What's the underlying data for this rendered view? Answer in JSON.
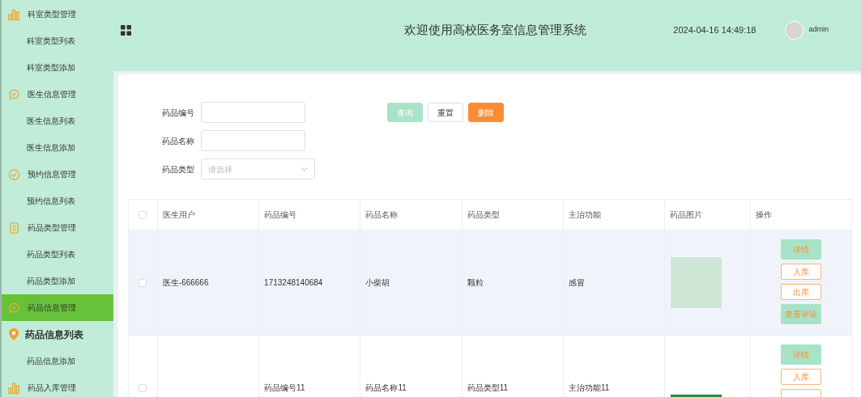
{
  "sidebar": {
    "items": [
      {
        "label": "科室类型管理",
        "kind": "group",
        "selected": false
      },
      {
        "label": "科室类型列表",
        "kind": "sub",
        "selected": false
      },
      {
        "label": "科室类型添加",
        "kind": "sub",
        "selected": false
      },
      {
        "label": "医生信息管理",
        "kind": "group",
        "selected": false
      },
      {
        "label": "医生信息列表",
        "kind": "sub",
        "selected": false
      },
      {
        "label": "医生信息添加",
        "kind": "sub",
        "selected": false
      },
      {
        "label": "预约信息管理",
        "kind": "group",
        "selected": false
      },
      {
        "label": "预约信息列表",
        "kind": "sub",
        "selected": false
      },
      {
        "label": "药品类型管理",
        "kind": "group",
        "selected": false
      },
      {
        "label": "药品类型列表",
        "kind": "sub",
        "selected": false
      },
      {
        "label": "药品类型添加",
        "kind": "sub",
        "selected": false
      },
      {
        "label": "药品信息管理",
        "kind": "group",
        "selected": true
      },
      {
        "label": "药品信息列表",
        "kind": "sub",
        "selected": true
      },
      {
        "label": "药品信息添加",
        "kind": "sub",
        "selected": false
      },
      {
        "label": "药品入库管理",
        "kind": "group",
        "selected": false
      }
    ]
  },
  "header": {
    "title": "欢迎使用高校医务室信息管理系统",
    "datetime": "2024-04-16 14:49:18",
    "user": "admin"
  },
  "filters": [
    {
      "label": "药品编号",
      "kind": "input"
    },
    {
      "label": "药品名称",
      "kind": "input"
    },
    {
      "label": "药品类型",
      "kind": "select",
      "placeholder": "请选择"
    }
  ],
  "filter_buttons": [
    {
      "label": "查询",
      "kind": "primary"
    },
    {
      "label": "重置",
      "kind": "plain"
    },
    {
      "label": "删除",
      "kind": "danger"
    }
  ],
  "table": {
    "select_all_checked": false,
    "columns": [
      "医生用户",
      "药品编号",
      "药品名称",
      "药品类型",
      "主治功能",
      "药品图片",
      "操作"
    ],
    "rows": [
      {
        "checked": false,
        "highlighted": true,
        "cells": [
          "医生-666666",
          "1713248140684",
          "小柴胡",
          "颗粒",
          "感冒"
        ],
        "actions": [
          {
            "label": "详情",
            "kind": "fill"
          },
          {
            "label": "入库",
            "kind": "outline"
          },
          {
            "label": "出库",
            "kind": "outline"
          },
          {
            "label": "查看评论",
            "kind": "fill"
          }
        ]
      },
      {
        "checked": false,
        "highlighted": false,
        "cells": [
          "",
          "药品编号11",
          "药品名称11",
          "药品类型11",
          "主治功能11"
        ],
        "actions": [
          {
            "label": "详情",
            "kind": "fill"
          },
          {
            "label": "入库",
            "kind": "outline"
          }
        ]
      }
    ]
  }
}
